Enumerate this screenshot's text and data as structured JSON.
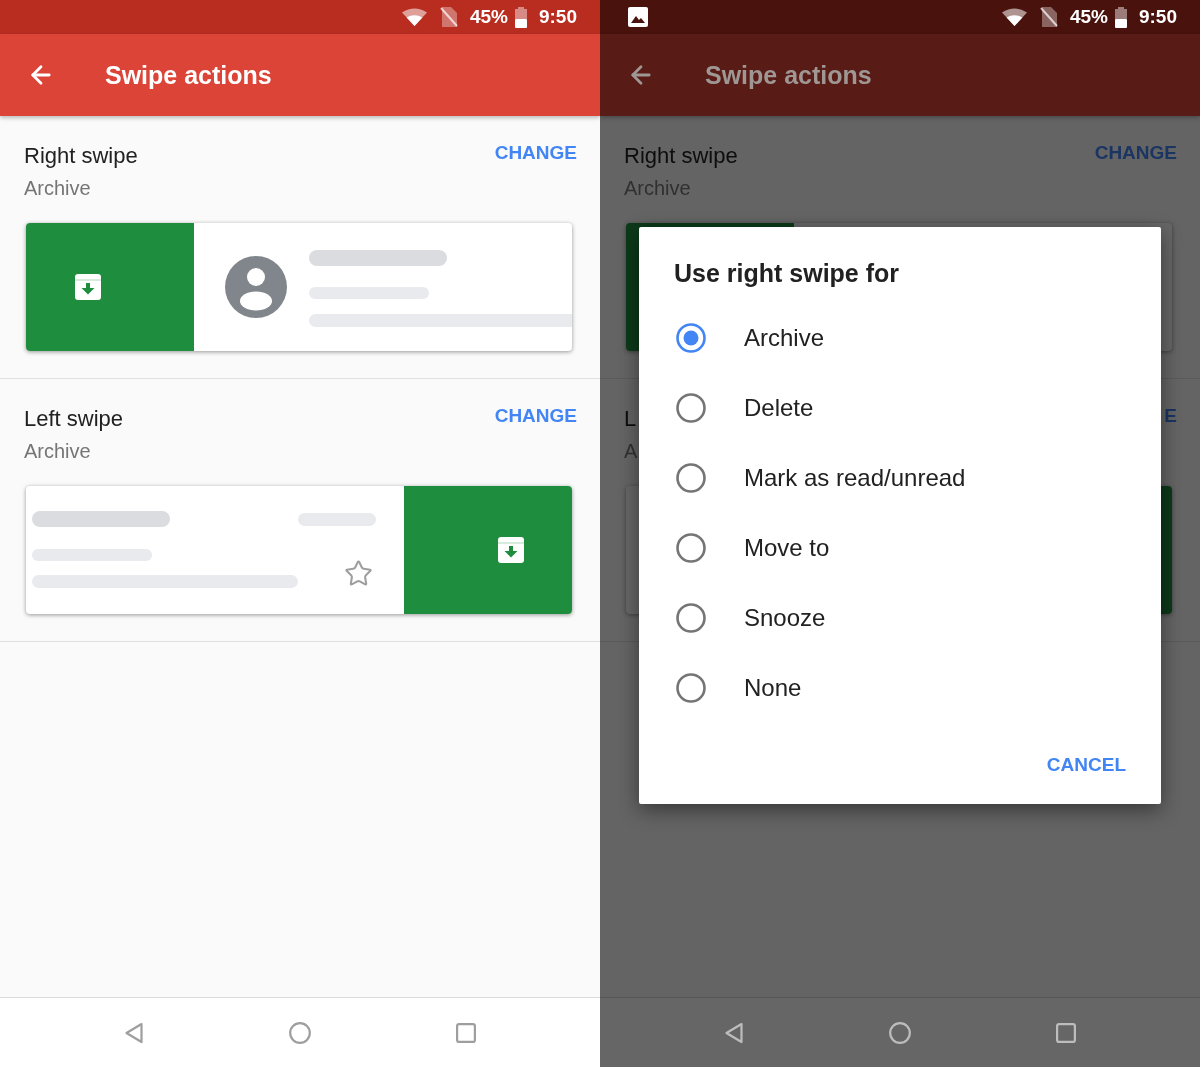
{
  "screens": [
    {
      "status_bar": {
        "notification": false,
        "battery": "45%",
        "time": "9:50"
      },
      "app_bar": {
        "title": "Swipe actions"
      },
      "settings": [
        {
          "title": "Right swipe",
          "value": "Archive",
          "action": "CHANGE",
          "kind": "right"
        },
        {
          "title": "Left swipe",
          "value": "Archive",
          "action": "CHANGE",
          "kind": "left"
        }
      ]
    },
    {
      "status_bar": {
        "notification": true,
        "battery": "45%",
        "time": "9:50"
      },
      "app_bar": {
        "title": "Swipe actions"
      },
      "settings": [
        {
          "title": "Right swipe",
          "value": "Archive",
          "action": "CHANGE",
          "kind": "right"
        },
        {
          "title": "L",
          "value": "A",
          "action": "E",
          "kind": "left"
        }
      ],
      "dialog": {
        "title": "Use right swipe for",
        "options": [
          {
            "label": "Archive",
            "selected": true
          },
          {
            "label": "Delete",
            "selected": false
          },
          {
            "label": "Mark as read/unread",
            "selected": false
          },
          {
            "label": "Move to",
            "selected": false
          },
          {
            "label": "Snooze",
            "selected": false
          },
          {
            "label": "None",
            "selected": false
          }
        ],
        "button": "CANCEL"
      }
    }
  ]
}
